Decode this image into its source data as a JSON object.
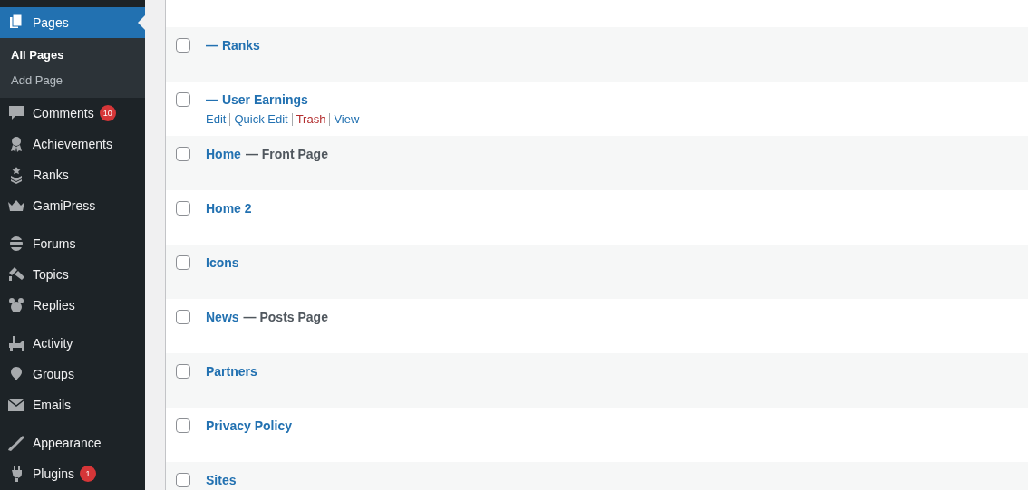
{
  "sidebar": {
    "groups": [
      {
        "items": [
          {
            "label": "Pages",
            "selected": true,
            "submenu": [
              {
                "label": "All Pages",
                "selected": true
              },
              {
                "label": "Add Page",
                "selected": false
              }
            ]
          },
          {
            "label": "Comments",
            "selected": false,
            "badge": "10"
          },
          {
            "label": "Achievements",
            "selected": false
          },
          {
            "label": "Ranks",
            "selected": false
          },
          {
            "label": "GamiPress",
            "selected": false
          }
        ]
      },
      {
        "items": [
          {
            "label": "Forums",
            "selected": false
          },
          {
            "label": "Topics",
            "selected": false
          },
          {
            "label": "Replies",
            "selected": false
          }
        ]
      },
      {
        "items": [
          {
            "label": "Activity",
            "selected": false
          },
          {
            "label": "Groups",
            "selected": false
          },
          {
            "label": "Emails",
            "selected": false
          }
        ]
      },
      {
        "items": [
          {
            "label": "Appearance",
            "selected": false
          },
          {
            "label": "Plugins",
            "selected": false,
            "badge": "1"
          }
        ]
      }
    ]
  },
  "table": {
    "rows": [
      {
        "title": "— Ranks",
        "checked": false
      },
      {
        "title": "— User Earnings",
        "checked": false,
        "actions": [
          {
            "label": "Edit",
            "kind": "link"
          },
          {
            "label": "Quick Edit",
            "kind": "link"
          },
          {
            "label": "Trash",
            "kind": "delete"
          },
          {
            "label": "View",
            "kind": "link"
          }
        ]
      },
      {
        "title": "Home",
        "state": "— Front Page",
        "checked": false
      },
      {
        "title": "Home 2",
        "checked": false
      },
      {
        "title": "Icons",
        "checked": false
      },
      {
        "title": "News",
        "state": "— Posts Page",
        "checked": false
      },
      {
        "title": "Partners",
        "checked": false
      },
      {
        "title": "Privacy Policy",
        "checked": false
      },
      {
        "title": "Sites",
        "checked": false
      }
    ]
  }
}
